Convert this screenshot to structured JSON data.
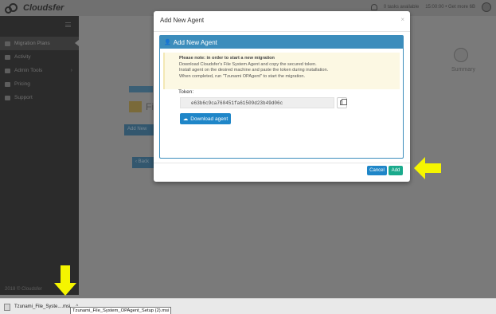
{
  "header": {
    "logo_text": "Cloudsfer",
    "status_text": "0 tasks available",
    "user_text": "15:00:00 • Get more 6B"
  },
  "sidebar": {
    "items": [
      {
        "label": "Migration Plans",
        "icon": "cloud-icon",
        "active": true
      },
      {
        "label": "Activity",
        "icon": "chart-icon",
        "active": false
      },
      {
        "label": "Admin Tools",
        "icon": "users-icon",
        "active": false,
        "has_chevron": true
      },
      {
        "label": "Pricing",
        "icon": "dollar-icon",
        "active": false
      },
      {
        "label": "Support",
        "icon": "help-icon",
        "active": false
      }
    ],
    "copyright": "2018 © Cloudsfer"
  },
  "background": {
    "summary_label": "Summary",
    "title_partial": "Fi",
    "add_button": "Add New",
    "back_button": "‹ Back"
  },
  "modal": {
    "title": "Add New Agent",
    "close": "×",
    "panel_title": "Add New Agent",
    "note": {
      "heading": "Please note: in order to start a new migration",
      "line1": "Download Cloudsfer's File System Agent and copy the secured token.",
      "line2": "Install agent on the desired machine and paste the token during installation.",
      "line3": "When completed, run \"Tzunami OPAgent\" to start the migration."
    },
    "token_label": "Token:",
    "token_value": "e63b6c9ca760451fa61509d23b49d06c",
    "download_button": "Download agent",
    "cancel_button": "Cancel",
    "add_button": "Add"
  },
  "download_bar": {
    "file_label": "Tzunami_File_Syste....msi",
    "caret": "^",
    "tooltip": "Tzunami_File_System_OPAgent_Setup (2).msi"
  },
  "colors": {
    "primary": "#1f86c8",
    "panel": "#3c8dbc",
    "add": "#1aaa8c",
    "note_bg": "#fcf8e3",
    "arrow": "#f5f500"
  }
}
